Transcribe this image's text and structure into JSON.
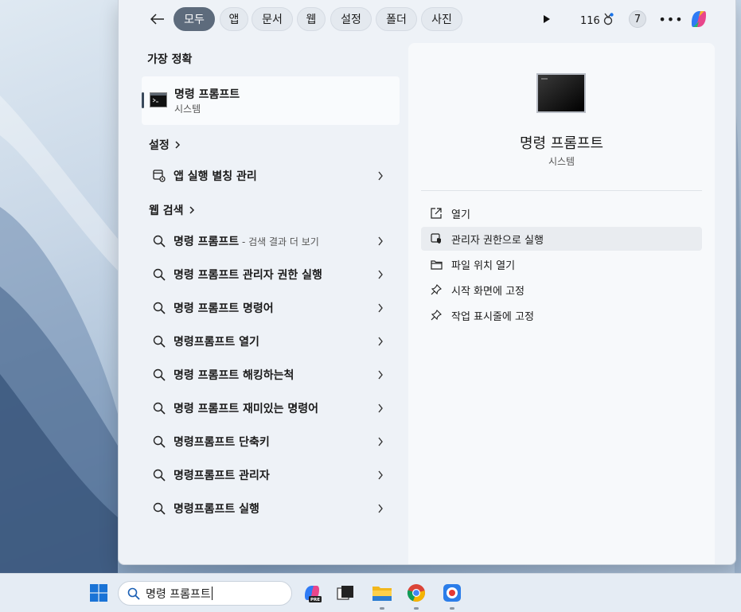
{
  "colors": {
    "accent": "#3b4a5c",
    "active_tab": "#5d6b7c",
    "panel": "#eef2f7"
  },
  "tabs": [
    {
      "label": "모두",
      "active": true
    },
    {
      "label": "앱"
    },
    {
      "label": "문서"
    },
    {
      "label": "웹"
    },
    {
      "label": "설정"
    },
    {
      "label": "폴더"
    },
    {
      "label": "사진"
    }
  ],
  "topbar": {
    "points": "116",
    "badge": "7",
    "icons": [
      "back-arrow-icon",
      "play-icon",
      "rewards-medal-icon",
      "more-icon",
      "copilot-icon"
    ]
  },
  "best_match": {
    "heading": "가장 정확",
    "name": "명령 프롬프트",
    "type": "시스템",
    "icon": "command-prompt-icon"
  },
  "settings": {
    "heading": "설정",
    "items": [
      {
        "label": "앱 실행 별칭 관리",
        "icon": "app-settings-icon"
      }
    ]
  },
  "web": {
    "heading": "웹 검색",
    "items": [
      {
        "label": "명령 프롬프트",
        "suffix": " - 검색 결과 더 보기"
      },
      {
        "label": "명령 프롬프트 관리자 권한 실행"
      },
      {
        "label": "명령 프롬프트 명령어"
      },
      {
        "label": "명령프롬프트 열기"
      },
      {
        "label": "명령 프롬프트 해킹하는척"
      },
      {
        "label": "명령 프롬프트 재미있는 명령어"
      },
      {
        "label": "명령프롬프트 단축키"
      },
      {
        "label": "명령프롬프트 관리자"
      },
      {
        "label": "명령프롬프트 실행"
      }
    ]
  },
  "detail": {
    "name": "명령 프롬프트",
    "type": "시스템",
    "actions": [
      {
        "label": "열기",
        "icon": "open-external-icon"
      },
      {
        "label": "관리자 권한으로 실행",
        "icon": "shield-admin-icon",
        "highlighted": true
      },
      {
        "label": "파일 위치 열기",
        "icon": "folder-icon"
      },
      {
        "label": "시작 화면에 고정",
        "icon": "pin-icon"
      },
      {
        "label": "작업 표시줄에 고정",
        "icon": "pin-icon"
      }
    ]
  },
  "taskbar": {
    "search_value": "명령 프롬프트",
    "apps": [
      "windows-start-icon",
      "copilot-pre-icon",
      "task-view-icon",
      "file-explorer-icon",
      "chrome-icon",
      "screen-recorder-icon"
    ]
  }
}
